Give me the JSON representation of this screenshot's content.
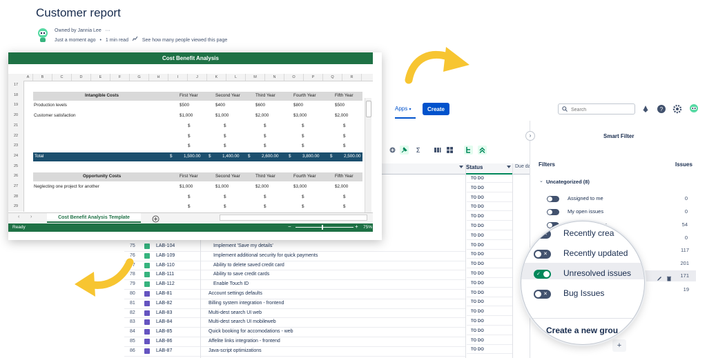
{
  "page": {
    "title": "Customer report",
    "owned_by": "Owned by Jannia Lee",
    "more": "···",
    "time_ago": "Just a moment ago",
    "dot": "•",
    "read_time": "1 min read",
    "views_link": "See how many people viewed this page"
  },
  "jira": {
    "nav_fragment": "ts",
    "apps": "Apps",
    "create": "Create",
    "search_placeholder": "Search",
    "toolbar_fragment": "y",
    "status_header": "Status",
    "due_header": "Due da",
    "status_values": [
      "TO DO",
      "TO DO",
      "TO DO",
      "TO DO",
      "TO DO",
      "TO DO",
      "TO DO",
      "TO DO",
      "TO DO",
      "TO DO",
      "TO DO",
      "TO DO",
      "TO DO",
      "TO DO",
      "TO DO",
      "TO DO",
      "TO DO",
      "TO DO",
      "TO DO"
    ],
    "issues": [
      {
        "num": "75",
        "key": "LAB-104",
        "summary": "Implement 'Save my details'",
        "type": "story"
      },
      {
        "num": "76",
        "key": "LAB-109",
        "summary": "Implement additional security for quick payments",
        "type": "story"
      },
      {
        "num": "77",
        "key": "LAB-110",
        "summary": "Ability to delete saved credit card",
        "type": "story"
      },
      {
        "num": "78",
        "key": "LAB-111",
        "summary": "Ability to save credit cards",
        "type": "story"
      },
      {
        "num": "79",
        "key": "LAB-112",
        "summary": "Enable Touch ID",
        "type": "story"
      },
      {
        "num": "80",
        "key": "LAB-81",
        "summary": "Account settings defaults",
        "type": "epic"
      },
      {
        "num": "81",
        "key": "LAB-82",
        "summary": "Billing system integration - frontend",
        "type": "epic"
      },
      {
        "num": "82",
        "key": "LAB-83",
        "summary": "Multi-dest search UI web",
        "type": "epic"
      },
      {
        "num": "83",
        "key": "LAB-84",
        "summary": "Multi-dest search UI mobileweb",
        "type": "epic"
      },
      {
        "num": "84",
        "key": "LAB-85",
        "summary": "Quick booking for accomodations - web",
        "type": "epic"
      },
      {
        "num": "85",
        "key": "LAB-86",
        "summary": "Affelite links integration - frontend",
        "type": "epic"
      },
      {
        "num": "86",
        "key": "LAB-87",
        "summary": "Java-script optimizations",
        "type": "epic"
      }
    ],
    "colors": {
      "accent": "#0052cc",
      "story": "#36b37e",
      "epic": "#6554c0",
      "done": "#00875a"
    }
  },
  "filter_panel": {
    "title": "Smart Filter",
    "filters_label": "Filters",
    "issues_label": "Issues",
    "group": "Uncategorized (8)",
    "small_filters": [
      {
        "label": "Assigned to me",
        "count": "0"
      },
      {
        "label": "My open issues",
        "count": "0"
      },
      {
        "label": "me",
        "count": "54"
      },
      {
        "label": "",
        "count": "0"
      }
    ],
    "magnified_filters": [
      {
        "label": "Recently crea",
        "on": false
      },
      {
        "label": "Recently updated",
        "on": false
      },
      {
        "label": "Unresolved issues",
        "on": true
      },
      {
        "label": "Bug Issues",
        "on": false
      }
    ],
    "right_counts": [
      "117",
      "201",
      "171",
      "19"
    ],
    "create_group": "Create a new grou",
    "add": "+"
  },
  "sheet": {
    "title": "Cost Benefit Analysis",
    "columns": [
      "A",
      "B",
      "C",
      "D",
      "E",
      "F",
      "G",
      "H",
      "I",
      "J",
      "K",
      "L",
      "M",
      "N",
      "O",
      "P",
      "Q",
      "R"
    ],
    "rows": [
      "17",
      "18",
      "19",
      "20",
      "21",
      "22",
      "23",
      "24",
      "25",
      "26",
      "27",
      "28",
      "29"
    ],
    "intangible": {
      "header": "Intangible Costs",
      "years": [
        "First Year",
        "Second Year",
        "Third Year",
        "Fourth Year",
        "Fifth Year"
      ],
      "lines": [
        {
          "label": "Production levels",
          "values": [
            "$500",
            "$400",
            "$600",
            "$800",
            "$500"
          ]
        },
        {
          "label": "Customer satisfaction",
          "values": [
            "$1,000",
            "$1,000",
            "$2,000",
            "$3,000",
            "$2,000"
          ]
        },
        {
          "label": "",
          "values": [
            "$",
            "$",
            "$",
            "$",
            "$"
          ]
        },
        {
          "label": "",
          "values": [
            "$",
            "$",
            "$",
            "$",
            "$"
          ]
        },
        {
          "label": "",
          "values": [
            "$",
            "$",
            "$",
            "$",
            "$"
          ]
        }
      ]
    },
    "total": {
      "label": "Total",
      "cur": "$",
      "values": [
        "1,500.00",
        "1,400.00",
        "2,600.00",
        "3,800.00",
        "2,500.00"
      ]
    },
    "opportunity": {
      "header": "Opportunity Costs",
      "years": [
        "First Year",
        "Second Year",
        "Third Year",
        "Fourth Year",
        "Fifth Year"
      ],
      "lines": [
        {
          "label": "Neglecting one project for another",
          "values": [
            "$1,000",
            "$1,000",
            "$2,000",
            "$3,000",
            "$2,000"
          ]
        },
        {
          "label": "",
          "values": [
            "$",
            "$",
            "$",
            "$",
            "$"
          ]
        },
        {
          "label": "",
          "values": [
            "$",
            "$",
            "$",
            "$",
            "$"
          ]
        }
      ]
    },
    "tab": "Cost Benefit Analysis Template",
    "status": "Ready",
    "zoom": "75%",
    "colors": {
      "green": "#1e7145",
      "navy": "#1c4f6e"
    }
  },
  "decor": {
    "arrow_color": "#f7c531"
  }
}
